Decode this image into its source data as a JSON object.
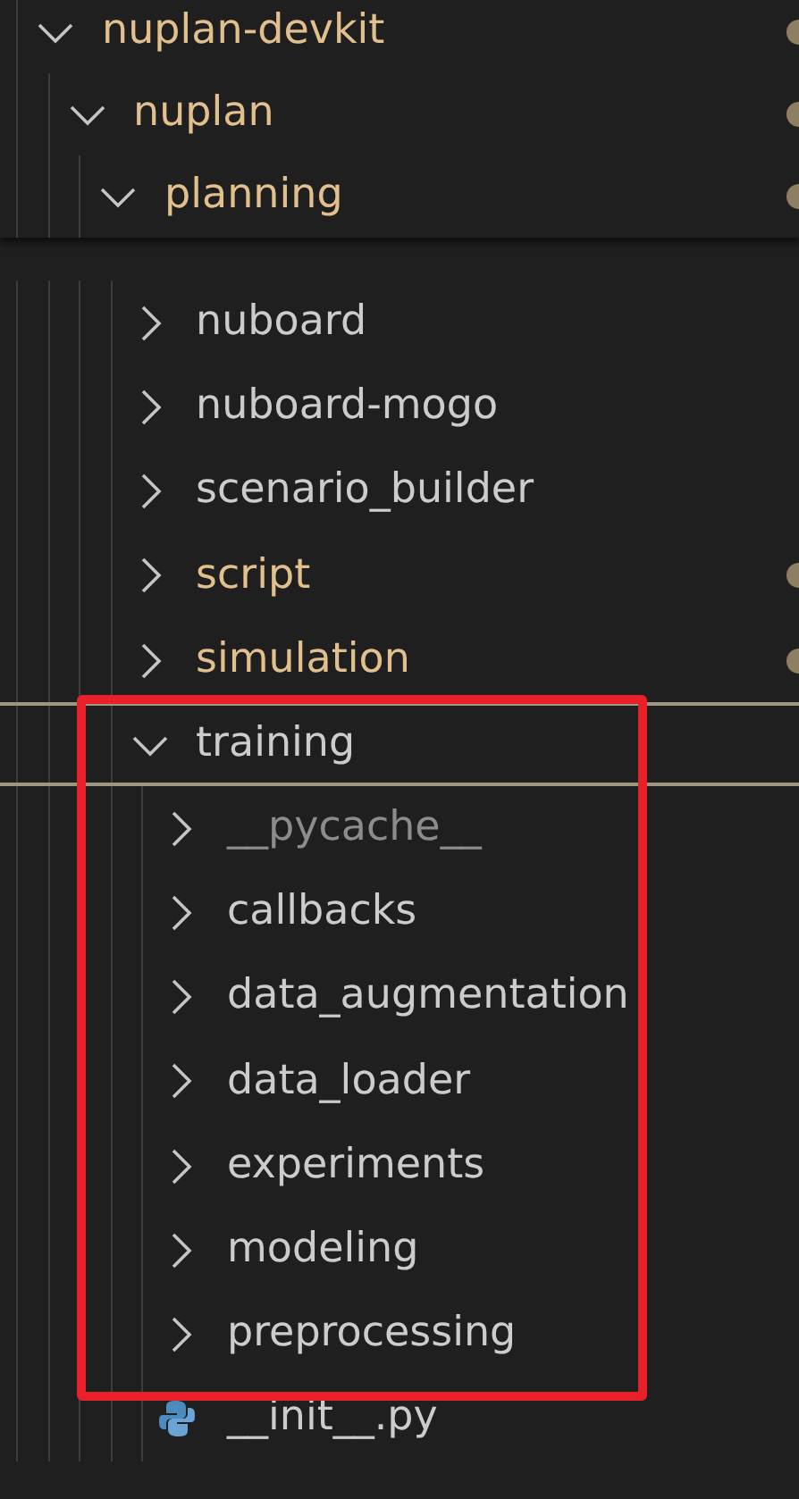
{
  "explorer": {
    "tree": [
      {
        "label": "nuplan-devkit",
        "kind": "folder",
        "expanded": true,
        "modified": true,
        "ignored": false,
        "children": [
          {
            "label": "nuplan",
            "kind": "folder",
            "expanded": true,
            "modified": true,
            "ignored": false,
            "children": [
              {
                "label": "planning",
                "kind": "folder",
                "expanded": true,
                "modified": true,
                "ignored": false,
                "children": [
                  {
                    "label": "nuboard",
                    "kind": "folder",
                    "expanded": false,
                    "modified": false,
                    "ignored": false
                  },
                  {
                    "label": "nuboard-mogo",
                    "kind": "folder",
                    "expanded": false,
                    "modified": false,
                    "ignored": false
                  },
                  {
                    "label": "scenario_builder",
                    "kind": "folder",
                    "expanded": false,
                    "modified": false,
                    "ignored": false
                  },
                  {
                    "label": "script",
                    "kind": "folder",
                    "expanded": false,
                    "modified": true,
                    "ignored": false
                  },
                  {
                    "label": "simulation",
                    "kind": "folder",
                    "expanded": false,
                    "modified": true,
                    "ignored": false
                  },
                  {
                    "label": "training",
                    "kind": "folder",
                    "expanded": true,
                    "focused": true,
                    "modified": false,
                    "ignored": false,
                    "children": [
                      {
                        "label": "__pycache__",
                        "kind": "folder",
                        "expanded": false,
                        "modified": false,
                        "ignored": true
                      },
                      {
                        "label": "callbacks",
                        "kind": "folder",
                        "expanded": false,
                        "modified": false,
                        "ignored": false
                      },
                      {
                        "label": "data_augmentation",
                        "kind": "folder",
                        "expanded": false,
                        "modified": false,
                        "ignored": false
                      },
                      {
                        "label": "data_loader",
                        "kind": "folder",
                        "expanded": false,
                        "modified": false,
                        "ignored": false
                      },
                      {
                        "label": "experiments",
                        "kind": "folder",
                        "expanded": false,
                        "modified": false,
                        "ignored": false
                      },
                      {
                        "label": "modeling",
                        "kind": "folder",
                        "expanded": false,
                        "modified": false,
                        "ignored": false
                      },
                      {
                        "label": "preprocessing",
                        "kind": "folder",
                        "expanded": false,
                        "modified": false,
                        "ignored": false
                      },
                      {
                        "label": "__init__.py",
                        "kind": "python",
                        "modified": false,
                        "ignored": false
                      }
                    ]
                  }
                ]
              }
            ]
          }
        ]
      }
    ]
  }
}
